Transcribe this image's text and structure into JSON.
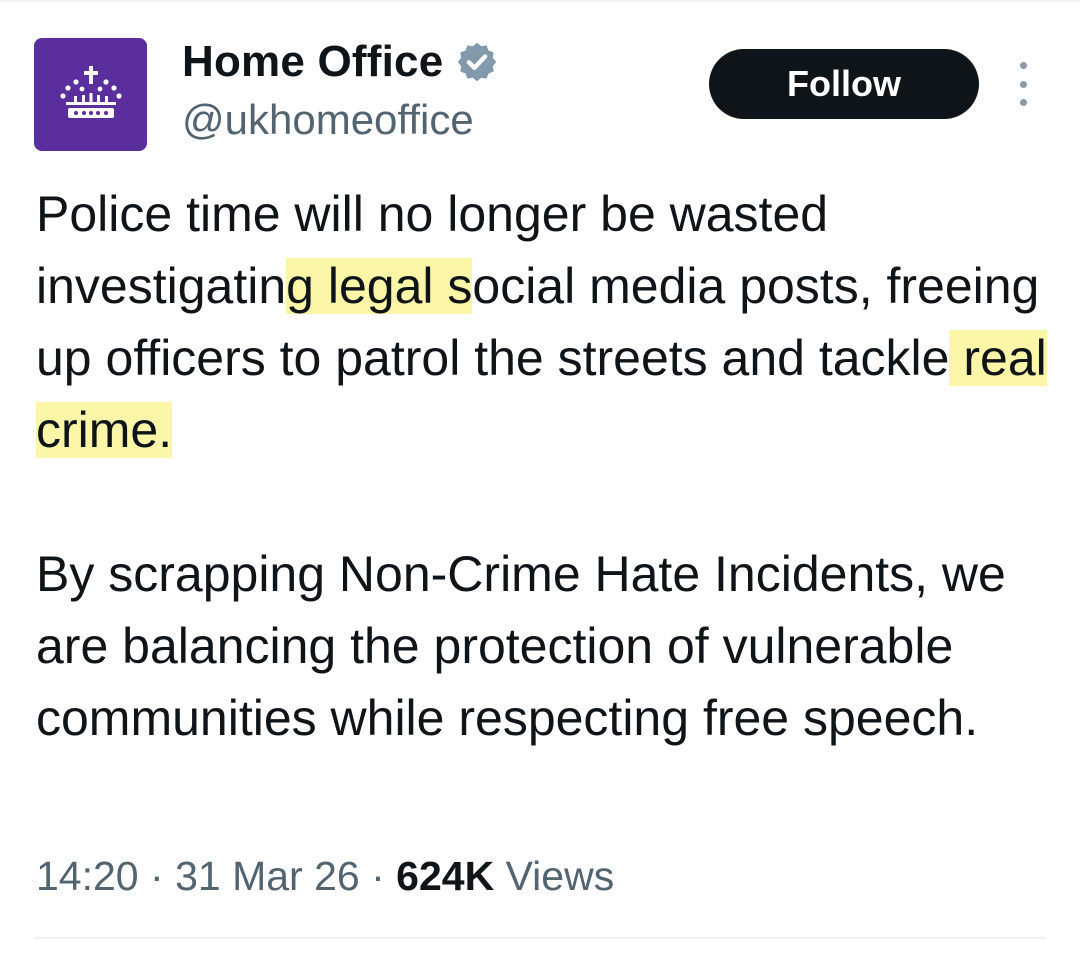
{
  "account": {
    "display_name": "Home Office",
    "handle": "@ukhomeoffice",
    "verified": true,
    "avatar_color": "#5b2e9e",
    "avatar_icon": "crown-icon",
    "verified_icon": "verified-badge-icon"
  },
  "actions": {
    "follow_label": "Follow",
    "more_icon": "more-options-icon"
  },
  "tweet": {
    "paragraph_1": {
      "part_1": "Police time will no longer be wasted investigatin",
      "highlight_1": "g legal s",
      "part_2": "ocial media posts, freeing up officers to patrol the streets and tackle",
      "highlight_2": " real crime. "
    },
    "paragraph_2": "By scrapping Non-Crime Hate Incidents, we are balancing the protection of vulnerable communities while respecting free speech.",
    "highlight_color": "#fbf5a8"
  },
  "meta": {
    "time": "14:20",
    "separator": "·",
    "date": "31 Mar 26",
    "views_count": "624K",
    "views_label": "Views"
  }
}
